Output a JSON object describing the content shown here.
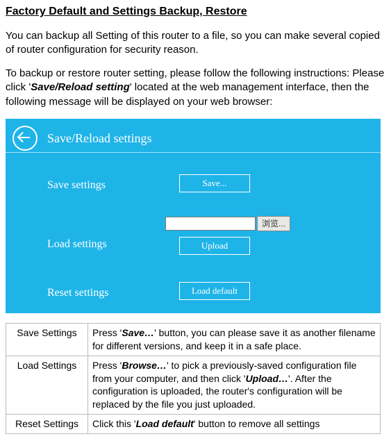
{
  "title": "Factory Default and Settings Backup, Restore",
  "intro": "You can backup all Setting of this router to a file, so you can make several copied of router configuration for security reason.",
  "instr_pre": "To backup or restore router setting, please follow the following instructions: Please click '",
  "instr_bold": "Save/Reload setting",
  "instr_post": "' located at the web management interface, then the following message will be displayed on your web browser:",
  "panel": {
    "title": "Save/Reload settings",
    "save_label": "Save settings",
    "load_label": "Load settings",
    "reset_label": "Reset settings",
    "btn_save": "Save...",
    "btn_upload": "Upload",
    "btn_reset": "Load default",
    "browse_btn": "浏览...",
    "file_value": ""
  },
  "table": {
    "r1": {
      "name": "Save Settings",
      "d_pre": "Press '",
      "d_b": "Save…",
      "d_post": "' button, you can please save it as another filename for different versions, and keep it in a safe place."
    },
    "r2": {
      "name": "Load Settings",
      "d_pre": "Press '",
      "d_b1": "Browse…",
      "d_mid": "' to pick a previously-saved configuration file from your computer, and then click '",
      "d_b2": "Upload…",
      "d_post": "'. After the configuration is uploaded, the router's configuration will be replaced by the file you just uploaded."
    },
    "r3": {
      "name": "Reset Settings",
      "d_pre": "Click this '",
      "d_b": "Load default",
      "d_post": "' button to remove all settings"
    }
  }
}
